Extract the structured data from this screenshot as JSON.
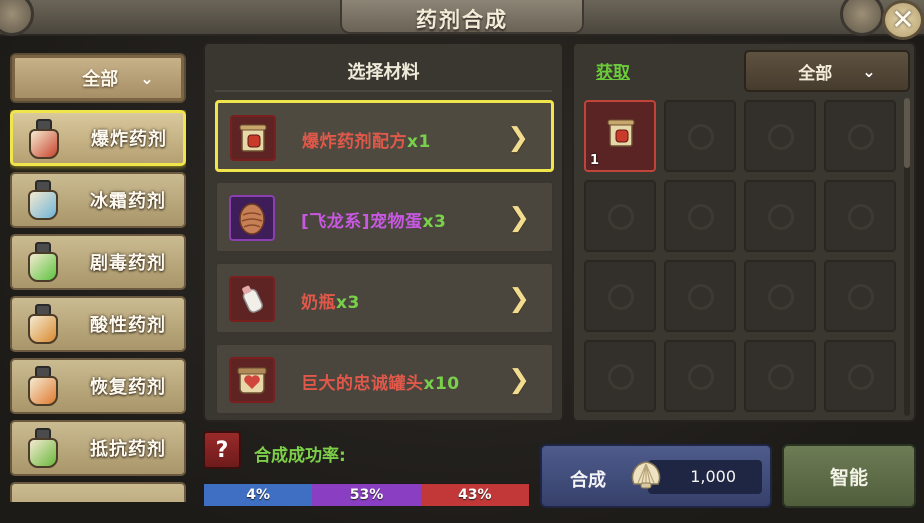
{
  "window": {
    "title": "药剂合成",
    "close_icon": "close-icon"
  },
  "category_filter": {
    "label": "全部",
    "icon": "chevron-down-icon"
  },
  "categories": [
    {
      "label": "爆炸药剂",
      "color": "#c9442f",
      "selected": true
    },
    {
      "label": "冰霜药剂",
      "color": "#6fb4d9",
      "selected": false
    },
    {
      "label": "剧毒药剂",
      "color": "#5cc440",
      "selected": false
    },
    {
      "label": "酸性药剂",
      "color": "#d98a30",
      "selected": false
    },
    {
      "label": "恢复药剂",
      "color": "#e07a30",
      "selected": false
    },
    {
      "label": "抵抗药剂",
      "color": "#6ab83c",
      "selected": false
    }
  ],
  "materials": {
    "header": "选择材料",
    "items": [
      {
        "name": "爆炸药剂配方",
        "qty": "x1",
        "name_color": "#e0584a",
        "icon": "recipe-scroll-icon",
        "selected": true
      },
      {
        "name": "[飞龙系]宠物蛋",
        "qty": "x3",
        "name_color": "#c659e0",
        "icon": "pet-egg-icon",
        "selected": false
      },
      {
        "name": "奶瓶",
        "qty": "x3",
        "name_color": "#e0584a",
        "icon": "milk-bottle-icon",
        "selected": false
      },
      {
        "name": "巨大的忠诚罐头",
        "qty": "x10",
        "name_color": "#e0584a",
        "icon": "loyalty-can-icon",
        "selected": false
      }
    ]
  },
  "obtain": {
    "label": "获取",
    "filter": {
      "label": "全部"
    },
    "slots": [
      {
        "filled": true,
        "count": "1",
        "icon": "recipe-scroll-icon"
      }
    ]
  },
  "success_rate": {
    "label": "合成成功率:",
    "segments": [
      {
        "label": "4%",
        "value": 4,
        "color": "#3f6fc2"
      },
      {
        "label": "53%",
        "value": 53,
        "color": "#8a3fc2"
      },
      {
        "label": "43%",
        "value": 43,
        "color": "#c23838"
      }
    ]
  },
  "craft_button": {
    "label": "合成",
    "cost": "1,000",
    "currency_icon": "shell-icon"
  },
  "smart_button": {
    "label": "智能"
  },
  "help_button": {
    "label": "?"
  }
}
